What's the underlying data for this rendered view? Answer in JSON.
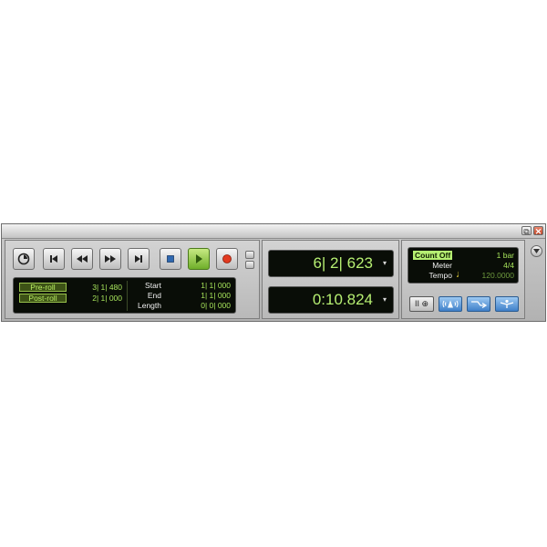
{
  "window": {
    "restore_glyph": "⧉",
    "close_glyph": "✕"
  },
  "transport": {
    "buttons": [
      {
        "name": "online-button",
        "icon": "clock-icon"
      },
      {
        "name": "return-to-zero-button",
        "icon": "skip-back-icon"
      },
      {
        "name": "rewind-button",
        "icon": "rewind-icon"
      },
      {
        "name": "fast-forward-button",
        "icon": "fast-forward-icon"
      },
      {
        "name": "go-to-end-button",
        "icon": "skip-forward-icon"
      },
      {
        "name": "stop-button",
        "icon": "stop-icon"
      },
      {
        "name": "play-button",
        "icon": "play-icon",
        "active": true
      },
      {
        "name": "record-button",
        "icon": "record-icon"
      }
    ]
  },
  "prepost": {
    "preroll_label": "Pre-roll",
    "preroll_value": "3| 1| 480",
    "postroll_label": "Post-roll",
    "postroll_value": "2| 1| 000"
  },
  "selection": {
    "start_label": "Start",
    "start_value": "1| 1| 000",
    "end_label": "End",
    "end_value": "1| 1| 000",
    "length_label": "Length",
    "length_value": "0| 0| 000"
  },
  "counters": {
    "main": "6| 2| 623",
    "sub": "0:10.824",
    "dropdown_glyph": "▾"
  },
  "midi": {
    "countoff_label": "Count Off",
    "countoff_value": "1 bar",
    "meter_label": "Meter",
    "meter_value": "4/4",
    "tempo_label": "Tempo",
    "tempo_value": "120.0000",
    "note_glyph": "♩",
    "wait_for_note_glyph": "II ⊕"
  },
  "colors": {
    "lcd_green": "#a6e35b",
    "play_green": "#6fae2a",
    "record_red": "#e23a20",
    "midi_blue": "#3f80c9"
  }
}
